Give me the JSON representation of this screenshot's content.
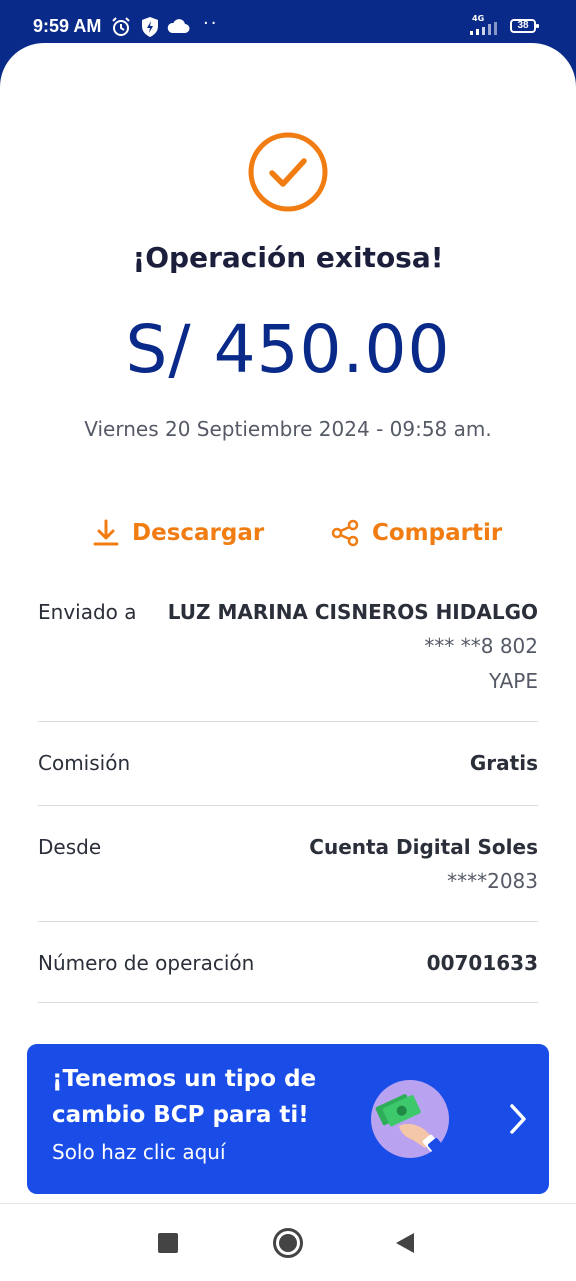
{
  "status_bar": {
    "time": "9:59 AM",
    "network": "4G",
    "battery": "38"
  },
  "receipt": {
    "title": "¡Operación exitosa!",
    "amount": "S/ 450.00",
    "datetime": "Viernes 20 Septiembre 2024 - 09:58 am."
  },
  "actions": {
    "download": "Descargar",
    "share": "Compartir"
  },
  "details": {
    "sent_to": {
      "label": "Enviado a",
      "name": "LUZ MARINA CISNEROS HIDALGO",
      "phone": "*** **8 802",
      "service": "YAPE"
    },
    "commission": {
      "label": "Comisión",
      "value": "Gratis"
    },
    "from": {
      "label": "Desde",
      "account": "Cuenta Digital Soles",
      "number": "****2083"
    },
    "operation": {
      "label": "Número de operación",
      "value": "00701633"
    }
  },
  "banner": {
    "line1": "¡Tenemos un tipo de",
    "line2": "cambio BCP para ti!",
    "sub": "Solo haz clic aquí"
  },
  "icons": {
    "success": "check-circle-icon",
    "download": "download-icon",
    "share": "share-icon",
    "promo": "money-hand-illustration",
    "banner_arrow": "chevron-right-icon",
    "nav": [
      "stop-square-icon",
      "home-circle-icon",
      "back-triangle-icon"
    ]
  },
  "colors": {
    "brand_blue": "#0a2a8a",
    "accent_orange": "#f07c12",
    "banner_blue": "#1a4de8"
  }
}
